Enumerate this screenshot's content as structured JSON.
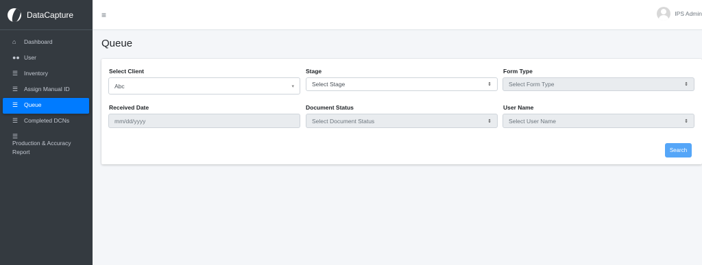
{
  "app": {
    "brand": "DataCapture"
  },
  "sidebar": {
    "items": [
      {
        "label": "Dashboard",
        "icon": "home-icon"
      },
      {
        "label": "User",
        "icon": "users-icon"
      },
      {
        "label": "Inventory",
        "icon": "list-icon"
      },
      {
        "label": "Assign Manual ID",
        "icon": "list-icon"
      },
      {
        "label": "Queue",
        "icon": "list-icon",
        "active": true
      },
      {
        "label": "Completed DCNs",
        "icon": "list-icon"
      },
      {
        "label": "Production & Accuracy Report",
        "icon": "list-icon"
      }
    ]
  },
  "header": {
    "user_name": "IPS Admin"
  },
  "page": {
    "title": "Queue"
  },
  "form": {
    "client": {
      "label": "Select Client",
      "value": "Abc"
    },
    "stage": {
      "label": "Stage",
      "value": "Select Stage"
    },
    "form_type": {
      "label": "Form Type",
      "value": "Select Form Type"
    },
    "received_date": {
      "label": "Received Date",
      "placeholder": "mm/dd/yyyy"
    },
    "document_status": {
      "label": "Document Status",
      "value": "Select Document Status"
    },
    "user_name": {
      "label": "User Name",
      "value": "Select User Name"
    },
    "search_label": "Search"
  },
  "colors": {
    "sidebar": "#343a40",
    "active": "#007bff",
    "search_button": "#55a6f8"
  }
}
